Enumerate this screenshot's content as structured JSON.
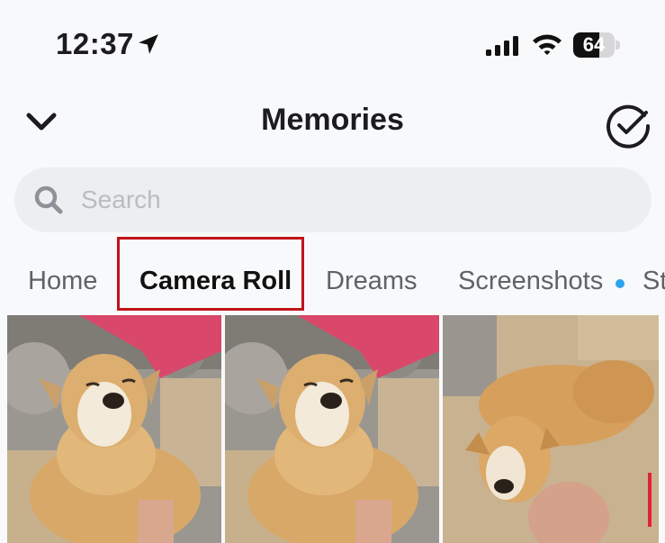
{
  "status_bar": {
    "time": "12:37",
    "battery": "64",
    "battery_level": 0.64
  },
  "header": {
    "title": "Memories"
  },
  "search": {
    "placeholder": "Search"
  },
  "tabs": [
    {
      "label": "Home"
    },
    {
      "label": "Camera Roll"
    },
    {
      "label": "Dreams"
    },
    {
      "label": "Screenshots"
    },
    {
      "label": "St"
    }
  ],
  "colors": {
    "highlight": "#c0141b",
    "new_indicator": "#2ba4f0"
  },
  "icons": [
    "location-arrow-icon",
    "signal-icon",
    "wifi-icon",
    "battery-icon",
    "chevron-down-icon",
    "check-circle-icon",
    "search-icon"
  ],
  "photos": [
    {
      "name": "dog-photo"
    },
    {
      "name": "dog-photo"
    },
    {
      "name": "dog-photo"
    }
  ]
}
